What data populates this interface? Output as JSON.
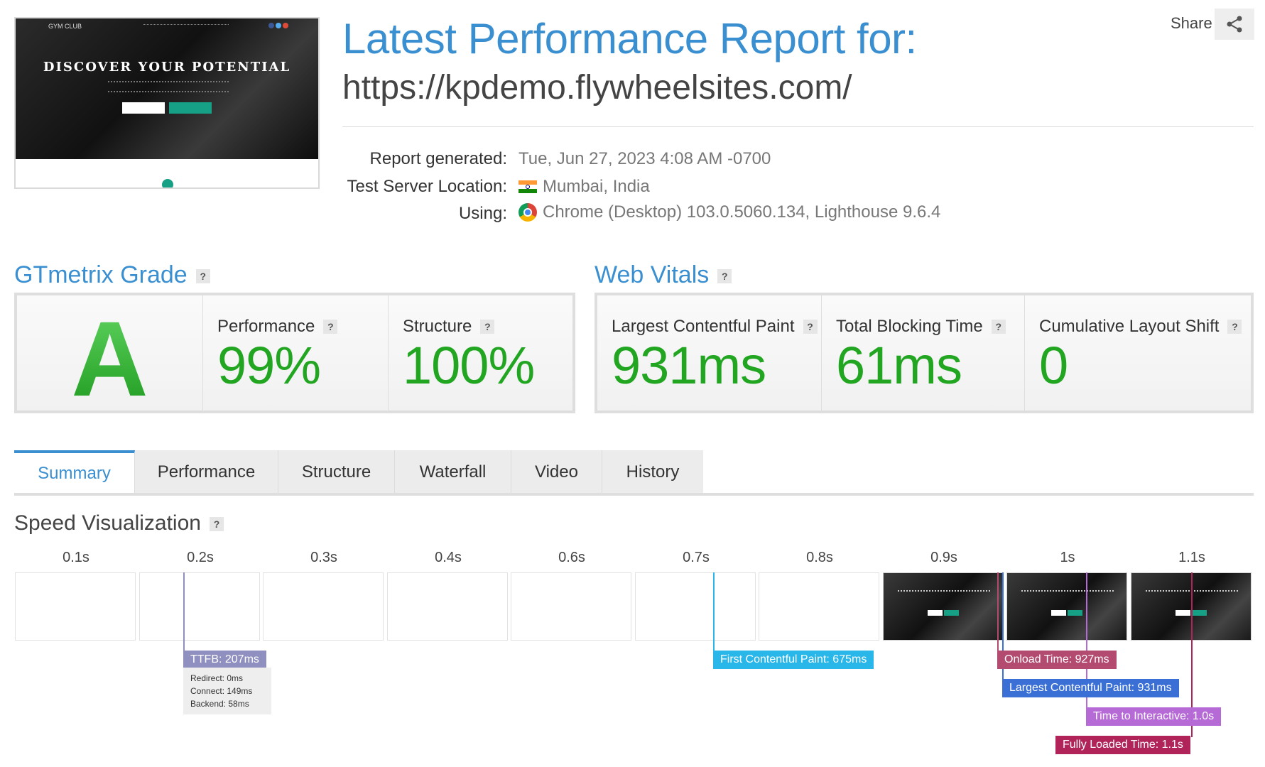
{
  "header": {
    "title": "Latest Performance Report for:",
    "url": "https://kpdemo.flywheelsites.com/",
    "share_label": "Share"
  },
  "thumbnail": {
    "logo_text": "GYM CLUB",
    "hero_text": "DISCOVER YOUR POTENTIAL"
  },
  "meta": {
    "report_generated_label": "Report generated:",
    "report_generated_value": "Tue, Jun 27, 2023 4:08 AM -0700",
    "location_label": "Test Server Location:",
    "location_value": "Mumbai, India",
    "using_label": "Using:",
    "using_value": "Chrome (Desktop) 103.0.5060.134, Lighthouse 9.6.4"
  },
  "grade": {
    "heading": "GTmetrix Grade",
    "letter": "A",
    "performance_label": "Performance",
    "performance_value": "99%",
    "structure_label": "Structure",
    "structure_value": "100%"
  },
  "vitals": {
    "heading": "Web Vitals",
    "lcp_label": "Largest Contentful Paint",
    "lcp_value": "931ms",
    "tbt_label": "Total Blocking Time",
    "tbt_value": "61ms",
    "cls_label": "Cumulative Layout Shift",
    "cls_value": "0"
  },
  "help_mark": "?",
  "tabs": [
    "Summary",
    "Performance",
    "Structure",
    "Waterfall",
    "Video",
    "History"
  ],
  "speed": {
    "title": "Speed Visualization",
    "ticks": [
      "0.1s",
      "0.2s",
      "0.3s",
      "0.4s",
      "0.6s",
      "0.7s",
      "0.8s",
      "0.9s",
      "1s",
      "1.1s"
    ],
    "ttfb": "TTFB: 207ms",
    "ttfb_redirect": "Redirect: 0ms",
    "ttfb_connect": "Connect: 149ms",
    "ttfb_backend": "Backend: 58ms",
    "fcp": "First Contentful Paint: 675ms",
    "onload": "Onload Time: 927ms",
    "lcp": "Largest Contentful Paint: 931ms",
    "tti": "Time to Interactive: 1.0s",
    "fully_loaded": "Fully Loaded Time: 1.1s"
  },
  "colors": {
    "accent": "#3a8fd1",
    "grade_green": "#22a622",
    "ttfb": "#8f8fc0",
    "fcp": "#29b6e8",
    "onload": "#b34a6f",
    "lcp": "#3a6fd6",
    "tti": "#b66ad6",
    "fully_loaded": "#b0245a"
  }
}
